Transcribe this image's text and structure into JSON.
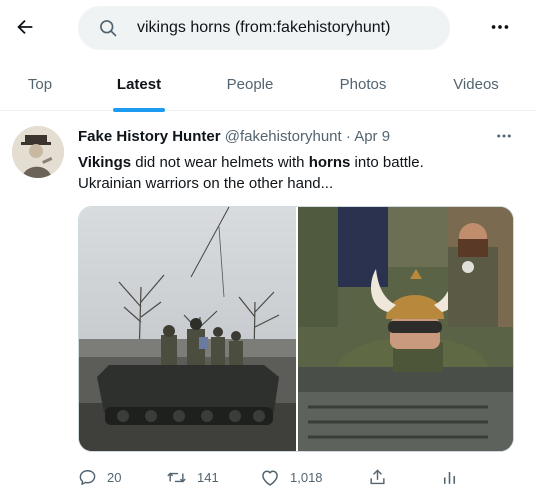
{
  "search": {
    "query": "vikings horns (from:fakehistoryhunt)"
  },
  "tabs": [
    {
      "label": "Top",
      "active": false
    },
    {
      "label": "Latest",
      "active": true
    },
    {
      "label": "People",
      "active": false
    },
    {
      "label": "Photos",
      "active": false
    },
    {
      "label": "Videos",
      "active": false
    }
  ],
  "tweet": {
    "author_name": "Fake History Hunter",
    "handle": "@fakehistoryhunt",
    "separator": "·",
    "date": "Apr 9",
    "text_line1": {
      "bold1": "Vikings",
      "mid": " did not wear helmets with ",
      "bold2": "horns",
      "end": " into battle."
    },
    "text_line2": "Ukrainian warriors on the other hand...",
    "media": [
      {
        "icon": "photo-armored-vehicle"
      },
      {
        "icon": "photo-horned-helmet-soldier"
      }
    ],
    "actions": {
      "reply_count": "20",
      "retweet_count": "141",
      "like_count": "1,018"
    }
  },
  "colors": {
    "accent": "#1d9bf0",
    "text_primary": "#0f1419",
    "text_secondary": "#536471",
    "search_bg": "#eff3f4"
  }
}
